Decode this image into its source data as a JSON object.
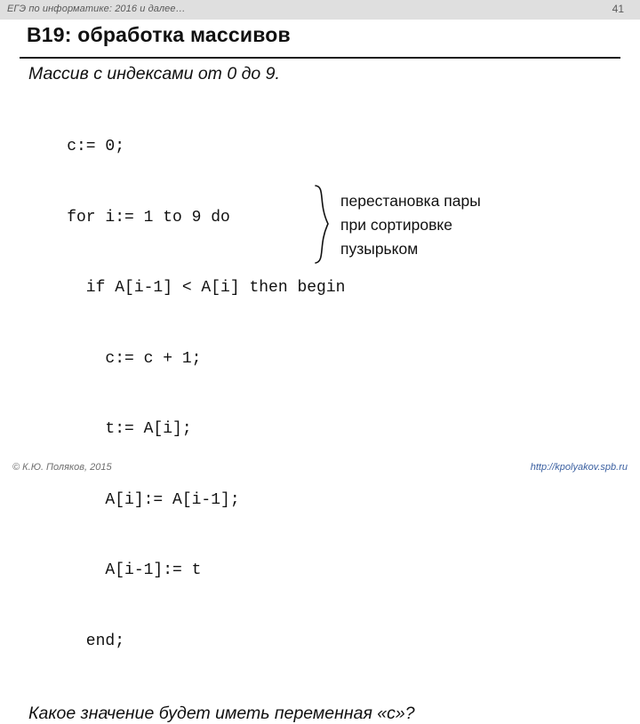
{
  "header": {
    "course_label": "ЕГЭ по информатике: 2016 и далее…",
    "slide_number": "41"
  },
  "slide": {
    "title": "B19: обработка массивов",
    "intro": "Массив с индексами от 0 до 9.",
    "code_lines": [
      "    c:= 0;",
      "    for i:= 1 to 9 do",
      "      if A[i-1] < A[i] then begin",
      "        c:= c + 1;",
      "        t:= A[i];",
      "        A[i]:= A[i-1];",
      "        A[i-1]:= t",
      "      end;"
    ],
    "question": "Какое значение будет иметь переменная «c»?",
    "annotation_lines": [
      "перестановка пары",
      "при сортировке",
      "пузырьком"
    ]
  },
  "footer": {
    "copyright": "© К.Ю. Поляков, 2015",
    "site": "http://kpolyakov.spb.ru"
  },
  "colors": {
    "header_bg": "#dfdfdf",
    "text": "#111111",
    "muted": "#5a5a5a",
    "link": "#3a5fa0"
  }
}
